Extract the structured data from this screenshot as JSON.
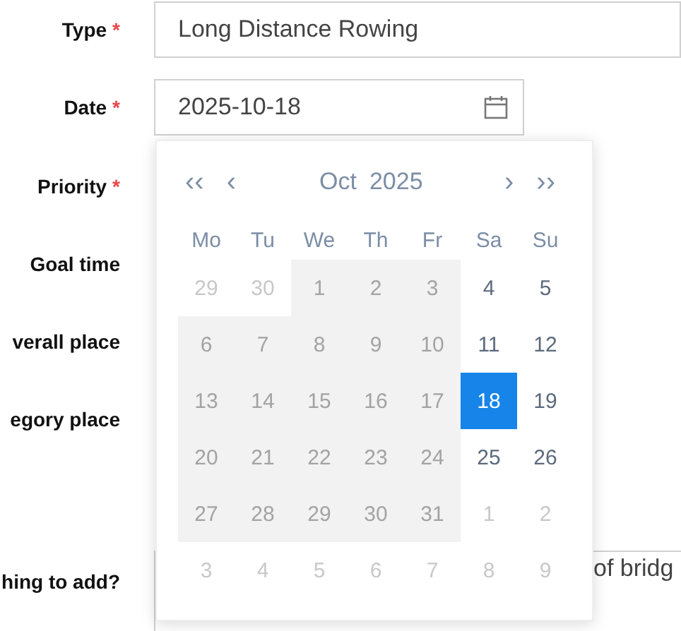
{
  "form": {
    "rows": [
      {
        "label": "Type",
        "required_mark": "*",
        "value": "Long Distance Rowing",
        "kind": "text"
      },
      {
        "label": "Date",
        "required_mark": "*",
        "value": "2025-10-18",
        "kind": "date"
      },
      {
        "label": "Priority",
        "required_mark": "*",
        "kind": "hidden"
      },
      {
        "label": "Goal time",
        "kind": "hidden"
      },
      {
        "label": "verall place",
        "kind": "hidden"
      },
      {
        "label": "egory place",
        "kind": "hidden"
      },
      {
        "label": "hing to add?",
        "value": "of bridg",
        "kind": "textarea"
      }
    ]
  },
  "calendar": {
    "prev_year": "‹‹",
    "prev_month": "‹",
    "month": "Oct",
    "year": "2025",
    "next_month": "›",
    "next_year": "››",
    "weekdays": [
      "Mo",
      "Tu",
      "We",
      "Th",
      "Fr",
      "Sa",
      "Su"
    ],
    "weeks": [
      [
        {
          "day": "29",
          "kind": "muted",
          "selected": false
        },
        {
          "day": "30",
          "kind": "muted",
          "selected": false
        },
        {
          "day": "1",
          "kind": "disabled",
          "selected": false
        },
        {
          "day": "2",
          "kind": "disabled",
          "selected": false
        },
        {
          "day": "3",
          "kind": "disabled",
          "selected": false
        },
        {
          "day": "4",
          "kind": "available",
          "selected": false
        },
        {
          "day": "5",
          "kind": "available",
          "selected": false
        }
      ],
      [
        {
          "day": "6",
          "kind": "disabled",
          "selected": false
        },
        {
          "day": "7",
          "kind": "disabled",
          "selected": false
        },
        {
          "day": "8",
          "kind": "disabled",
          "selected": false
        },
        {
          "day": "9",
          "kind": "disabled",
          "selected": false
        },
        {
          "day": "10",
          "kind": "disabled",
          "selected": false
        },
        {
          "day": "11",
          "kind": "available",
          "selected": false
        },
        {
          "day": "12",
          "kind": "available",
          "selected": false
        }
      ],
      [
        {
          "day": "13",
          "kind": "disabled",
          "selected": false
        },
        {
          "day": "14",
          "kind": "disabled",
          "selected": false
        },
        {
          "day": "15",
          "kind": "disabled",
          "selected": false
        },
        {
          "day": "16",
          "kind": "disabled",
          "selected": false
        },
        {
          "day": "17",
          "kind": "disabled",
          "selected": false
        },
        {
          "day": "18",
          "kind": "available",
          "selected": true
        },
        {
          "day": "19",
          "kind": "available",
          "selected": false
        }
      ],
      [
        {
          "day": "20",
          "kind": "disabled",
          "selected": false
        },
        {
          "day": "21",
          "kind": "disabled",
          "selected": false
        },
        {
          "day": "22",
          "kind": "disabled",
          "selected": false
        },
        {
          "day": "23",
          "kind": "disabled",
          "selected": false
        },
        {
          "day": "24",
          "kind": "disabled",
          "selected": false
        },
        {
          "day": "25",
          "kind": "available",
          "selected": false
        },
        {
          "day": "26",
          "kind": "available",
          "selected": false
        }
      ],
      [
        {
          "day": "27",
          "kind": "disabled",
          "selected": false
        },
        {
          "day": "28",
          "kind": "disabled",
          "selected": false
        },
        {
          "day": "29",
          "kind": "disabled",
          "selected": false
        },
        {
          "day": "30",
          "kind": "disabled",
          "selected": false
        },
        {
          "day": "31",
          "kind": "disabled",
          "selected": false
        },
        {
          "day": "1",
          "kind": "muted",
          "selected": false
        },
        {
          "day": "2",
          "kind": "muted",
          "selected": false
        }
      ],
      [
        {
          "day": "3",
          "kind": "muted",
          "selected": false
        },
        {
          "day": "4",
          "kind": "muted",
          "selected": false
        },
        {
          "day": "5",
          "kind": "muted",
          "selected": false
        },
        {
          "day": "6",
          "kind": "muted",
          "selected": false
        },
        {
          "day": "7",
          "kind": "muted",
          "selected": false
        },
        {
          "day": "8",
          "kind": "muted",
          "selected": false
        },
        {
          "day": "9",
          "kind": "muted",
          "selected": false
        }
      ]
    ]
  }
}
